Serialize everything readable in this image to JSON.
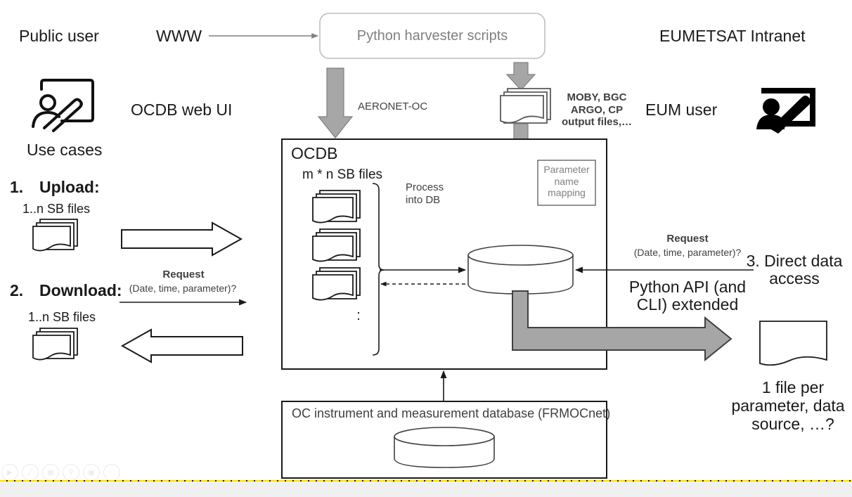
{
  "diagram": {
    "title_zones": {
      "public_user": "Public user",
      "www": "WWW",
      "eumetsat_intranet": "EUMETSAT Intranet"
    },
    "harvester_box": {
      "label": "Python harvester scripts"
    },
    "flows": {
      "aeronet": "AERONET-OC",
      "moby": "MOBY, BGC\nARGO, CP\noutput files,…",
      "process_into_db": "Process\ninto DB"
    },
    "left_panel": {
      "web_ui_label": "OCDB web UI",
      "use_cases_heading": "Use cases",
      "case1_number": "1.",
      "case1_label": "Upload:",
      "case1_files": "1..n SB files",
      "case2_number": "2.",
      "case2_label": "Download:",
      "case2_files": "1..n SB files",
      "request_line1": "Request",
      "request_line2": "(Date, time, parameter)?"
    },
    "ocdb_box": {
      "title": "OCDB",
      "subtitle": "m * n SB files",
      "ellipsis": ":",
      "param_mapping": "Parameter\nname\nmapping"
    },
    "right_panel": {
      "eum_user": "EUM user",
      "request_line1": "Request",
      "request_line2": "(Date, time, parameter)?",
      "api_line1": "Python API (and",
      "api_line2": "CLI) extended",
      "case3_line1": "3. Direct data",
      "case3_line2": "access",
      "output_caption_line1": "1 file per",
      "output_caption_line2": "parameter, data",
      "output_caption_line3": "source, …?"
    },
    "frmocnet_box": {
      "label": "OC instrument and measurement database (FRMOCnet)"
    },
    "toolbar": {
      "icons": [
        "play-icon",
        "pen-icon",
        "grid-icon",
        "magnifier-icon",
        "presentation-icon",
        "more-options-icon"
      ]
    },
    "colors": {
      "gray_arrow": "#a6a6a6",
      "outline": "#1a1a1a",
      "muted_text": "#808080",
      "highlight_dash": "#ffe000"
    }
  }
}
